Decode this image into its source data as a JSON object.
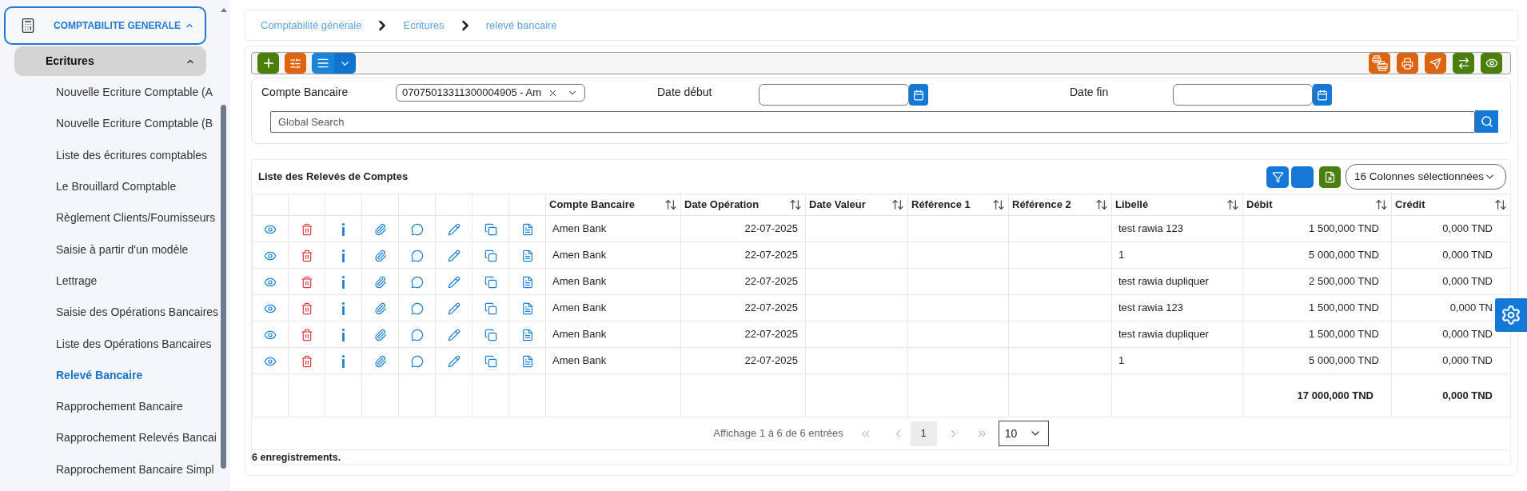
{
  "sidebar": {
    "section": {
      "label": "COMPTABILITE GENERALE",
      "expanded": true
    },
    "group": {
      "label": "Ecritures",
      "expanded": true
    },
    "items": [
      {
        "label": "Nouvelle Ecriture Comptable (A",
        "selected": false
      },
      {
        "label": "Nouvelle Ecriture Comptable (B",
        "selected": false
      },
      {
        "label": "Liste des écritures comptables",
        "selected": false
      },
      {
        "label": "Le Brouillard Comptable",
        "selected": false
      },
      {
        "label": "Règlement Clients/Fournisseurs",
        "selected": false
      },
      {
        "label": "Saisie à partir d'un modèle",
        "selected": false
      },
      {
        "label": "Lettrage",
        "selected": false
      },
      {
        "label": "Saisie des Opérations Bancaires",
        "selected": false
      },
      {
        "label": "Liste des Opérations Bancaires",
        "selected": false
      },
      {
        "label": "Relevé Bancaire",
        "selected": true
      },
      {
        "label": "Rapprochement Bancaire",
        "selected": false
      },
      {
        "label": "Rapprochement Relevés Bancai",
        "selected": false
      },
      {
        "label": "Rapprochement Bancaire Simpl",
        "selected": false
      }
    ]
  },
  "breadcrumb": [
    {
      "label": "Comptabilité générale"
    },
    {
      "label": "Ecritures"
    },
    {
      "label": "relevé bancaire"
    }
  ],
  "filters": {
    "account": {
      "label": "Compte Bancaire",
      "value": "07075013311300004905 - Am"
    },
    "date_start": {
      "label": "Date début"
    },
    "date_end": {
      "label": "Date fin"
    },
    "search": {
      "placeholder": "Global Search"
    }
  },
  "table": {
    "title": "Liste des Relevés de Comptes",
    "column_picker": "16 Colonnes sélectionnées",
    "columns": [
      "Compte Bancaire",
      "Date Opération",
      "Date Valeur",
      "Référence 1",
      "Référence 2",
      "Libellé",
      "Débit",
      "Crédit"
    ],
    "rows": [
      {
        "compte_bancaire": "Amen Bank",
        "date_operation": "22-07-2025",
        "libelle": "test rawia 123",
        "debit": "1 500,000 TND",
        "credit": "0,000 TND"
      },
      {
        "compte_bancaire": "Amen Bank",
        "date_operation": "22-07-2025",
        "libelle": "1",
        "debit": "5 000,000 TND",
        "credit": "0,000 TND"
      },
      {
        "compte_bancaire": "Amen Bank",
        "date_operation": "22-07-2025",
        "libelle": "test rawia dupliquer",
        "debit": "2 500,000 TND",
        "credit": "0,000 TND"
      },
      {
        "compte_bancaire": "Amen Bank",
        "date_operation": "22-07-2025",
        "libelle": "test rawia 123",
        "debit": "1 500,000 TND",
        "credit": "0,000 TN"
      },
      {
        "compte_bancaire": "Amen Bank",
        "date_operation": "22-07-2025",
        "libelle": "test rawia dupliquer",
        "debit": "1 500,000 TND",
        "credit": "0,000 TND"
      },
      {
        "compte_bancaire": "Amen Bank",
        "date_operation": "22-07-2025",
        "libelle": "1",
        "debit": "5 000,000 TND",
        "credit": "0,000 TND"
      }
    ],
    "totals": {
      "debit": "17 000,000 TND",
      "credit": "0,000 TND"
    }
  },
  "pagination": {
    "summary": "Affichage 1 à 6 de 6 entrées",
    "pages": [
      {
        "label": "1",
        "selected": true
      }
    ],
    "page_size": "10"
  },
  "record_count": "6 enregistrements."
}
